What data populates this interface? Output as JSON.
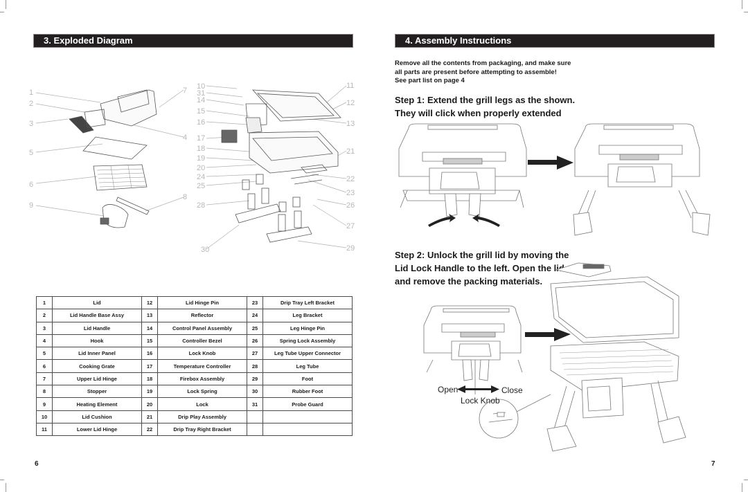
{
  "left_page": {
    "section_title": "3. Exploded Diagram",
    "callout_numbers": [
      "1",
      "2",
      "3",
      "4",
      "5",
      "6",
      "7",
      "8",
      "9",
      "10",
      "11",
      "12",
      "13",
      "14",
      "15",
      "16",
      "17",
      "18",
      "19",
      "20",
      "21",
      "22",
      "23",
      "24",
      "25",
      "26",
      "27",
      "28",
      "29",
      "30",
      "31"
    ],
    "parts_table": [
      [
        {
          "n": "1",
          "name": "Lid"
        },
        {
          "n": "12",
          "name": "Lid Hinge Pin"
        },
        {
          "n": "23",
          "name": "Drip Tray Left Bracket"
        }
      ],
      [
        {
          "n": "2",
          "name": "Lid Handle Base Assy"
        },
        {
          "n": "13",
          "name": "Reflector"
        },
        {
          "n": "24",
          "name": "Leg Bracket"
        }
      ],
      [
        {
          "n": "3",
          "name": "Lid Handle"
        },
        {
          "n": "14",
          "name": "Control Panel Assembly"
        },
        {
          "n": "25",
          "name": "Leg Hinge Pin"
        }
      ],
      [
        {
          "n": "4",
          "name": "Hook"
        },
        {
          "n": "15",
          "name": "Controller Bezel"
        },
        {
          "n": "26",
          "name": "Spring Lock Assembly"
        }
      ],
      [
        {
          "n": "5",
          "name": "Lid Inner Panel"
        },
        {
          "n": "16",
          "name": "Lock Knob"
        },
        {
          "n": "27",
          "name": "Leg Tube Upper Connector"
        }
      ],
      [
        {
          "n": "6",
          "name": "Cooking Grate"
        },
        {
          "n": "17",
          "name": "Temperature Controller"
        },
        {
          "n": "28",
          "name": "Leg Tube"
        }
      ],
      [
        {
          "n": "7",
          "name": "Upper Lid Hinge"
        },
        {
          "n": "18",
          "name": "Firebox Assembly"
        },
        {
          "n": "29",
          "name": "Foot"
        }
      ],
      [
        {
          "n": "8",
          "name": "Stopper"
        },
        {
          "n": "19",
          "name": "Lock Spring"
        },
        {
          "n": "30",
          "name": "Rubber Foot"
        }
      ],
      [
        {
          "n": "9",
          "name": "Heating Element"
        },
        {
          "n": "20",
          "name": "Lock"
        },
        {
          "n": "31",
          "name": "Probe Guard"
        }
      ],
      [
        {
          "n": "10",
          "name": "Lid Cushion"
        },
        {
          "n": "21",
          "name": "Drip Play Assembly"
        },
        {
          "n": "",
          "name": ""
        }
      ],
      [
        {
          "n": "11",
          "name": "Lower Lid Hinge"
        },
        {
          "n": "22",
          "name": "Drip Tray Right Bracket"
        },
        {
          "n": "",
          "name": ""
        }
      ]
    ],
    "page_number": "6"
  },
  "right_page": {
    "section_title": "4. Assembly Instructions",
    "intro_lines": [
      "Remove all the contents from packaging, and make sure",
      "all parts are present before attempting to assemble!",
      "See part list on page 4"
    ],
    "step1_lines": [
      "Step 1: Extend the grill legs as the shown.",
      "They will click when properly extended"
    ],
    "step2_lines": [
      "Step 2: Unlock the grill lid by moving the",
      "Lid Lock Handle to the left. Open the lid",
      "and remove the packing materials."
    ],
    "lock_labels": {
      "open": "Open",
      "close": "Close",
      "knob": "Lock Knob"
    },
    "page_number": "7"
  },
  "colors": {
    "header_bg": "#231f20",
    "header_text": "#ffffff",
    "line_art": "#9a9a9a"
  }
}
